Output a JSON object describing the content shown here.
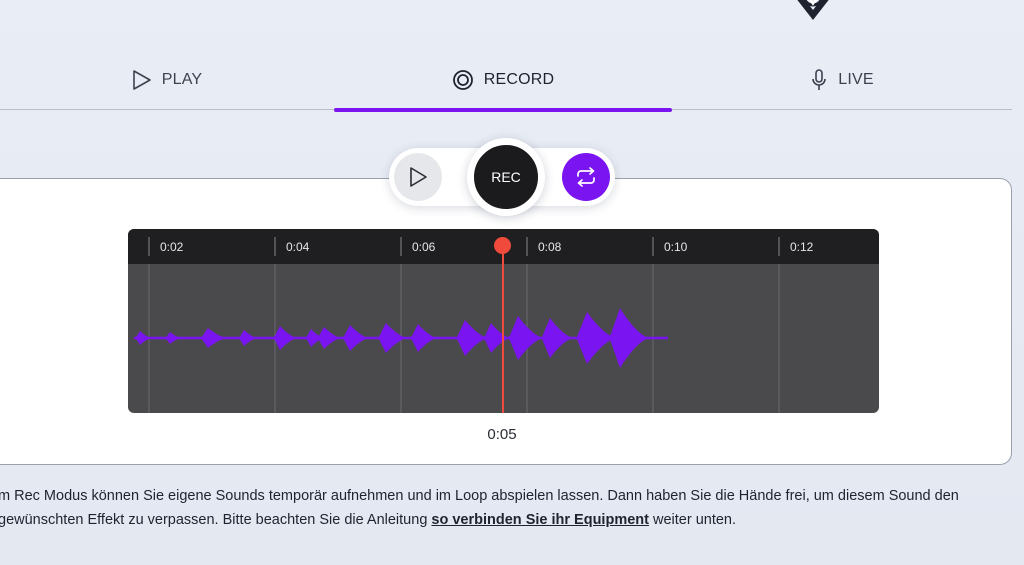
{
  "tabs": [
    {
      "label": "PLAY",
      "icon": "play-icon",
      "active": false
    },
    {
      "label": "RECORD",
      "icon": "record-icon",
      "active": true
    },
    {
      "label": "LIVE",
      "icon": "microphone-icon",
      "active": false
    }
  ],
  "colors": {
    "accent": "#7a14f0",
    "playhead": "#ef4a3c",
    "rec_button": "#1b1b1d",
    "timeline_bg": "#4a4a4c",
    "ruler_bg": "#1f1f21"
  },
  "controls": {
    "play_icon": "play-icon",
    "rec_label": "REC",
    "loop_icon": "loop-icon",
    "loop_active": true
  },
  "timeline": {
    "tick_labels": [
      "0:02",
      "0:04",
      "0:06",
      "0:08",
      "0:10",
      "0:12"
    ],
    "current_time": "0:05"
  },
  "description": {
    "text_before": "m Rec Modus können Sie eigene Sounds temporär aufnehmen und im Loop abspielen lassen. Dann haben Sie die Hände frei, um diesem Sound den gewünschten Effekt zu verpassen. Bitte beachten Sie die Anleitung ",
    "link_text": "so verbinden Sie ihr Equipment",
    "text_after": " weiter unten."
  }
}
